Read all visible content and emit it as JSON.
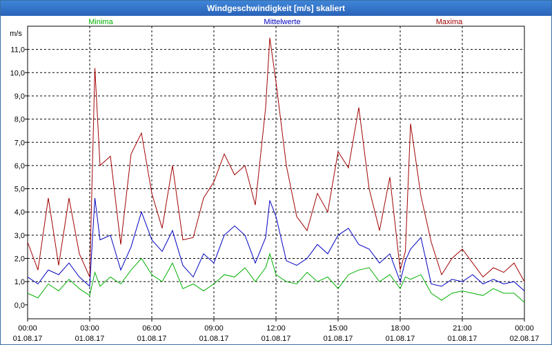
{
  "window": {
    "title": "Windgeschwindigkeit [m/s] skaliert"
  },
  "chart_data": {
    "type": "line",
    "title": "Windgeschwindigkeit [m/s] skaliert",
    "ylabel": "m/s",
    "ylim": [
      -0.6,
      12.0
    ],
    "yticks": [
      "0,0",
      "1,0",
      "2,0",
      "3,0",
      "4,0",
      "5,0",
      "6,0",
      "7,0",
      "8,0",
      "9,0",
      "10,0",
      "11,0"
    ],
    "xlabels": [
      {
        "time": "00:00",
        "date": "01.08.17"
      },
      {
        "time": "03:00",
        "date": "01.08.17"
      },
      {
        "time": "06:00",
        "date": "01.08.17"
      },
      {
        "time": "09:00",
        "date": "01.08.17"
      },
      {
        "time": "12:00",
        "date": "01.08.17"
      },
      {
        "time": "15:00",
        "date": "01.08.17"
      },
      {
        "time": "18:00",
        "date": "01.08.17"
      },
      {
        "time": "21:00",
        "date": "01.08.17"
      },
      {
        "time": "00:00",
        "date": "02.08.17"
      }
    ],
    "grid": true,
    "legend_placement": "top",
    "x_hours": [
      0,
      0.5,
      1,
      1.5,
      2,
      2.5,
      3,
      3.25,
      3.5,
      4,
      4.5,
      5,
      5.5,
      6,
      6.5,
      7,
      7.5,
      8,
      8.5,
      9,
      9.5,
      10,
      10.5,
      11,
      11.5,
      11.7,
      12,
      12.5,
      13,
      13.5,
      14,
      14.5,
      15,
      15.5,
      16,
      16.5,
      17,
      17.5,
      18,
      18.25,
      18.5,
      19,
      19.5,
      20,
      20.5,
      21,
      21.5,
      22,
      22.5,
      23,
      23.5,
      24
    ],
    "series": [
      {
        "name": "Minima",
        "color": "#00b000",
        "values": [
          0.5,
          0.3,
          0.9,
          0.6,
          1.1,
          0.7,
          0.4,
          1.4,
          0.8,
          1.2,
          0.9,
          1.5,
          2.0,
          1.3,
          1.0,
          1.8,
          0.7,
          0.9,
          0.6,
          0.9,
          1.3,
          1.2,
          1.6,
          1.0,
          1.6,
          2.2,
          1.3,
          1.0,
          0.9,
          1.4,
          1.0,
          1.2,
          0.7,
          1.3,
          1.5,
          1.6,
          1.0,
          1.3,
          0.7,
          1.2,
          1.1,
          1.3,
          0.5,
          0.2,
          0.5,
          0.6,
          0.5,
          0.4,
          0.7,
          0.5,
          0.5,
          0.1
        ]
      },
      {
        "name": "Mittelwerte",
        "color": "#0000c0",
        "values": [
          1.2,
          0.9,
          1.5,
          1.3,
          1.8,
          1.2,
          0.8,
          4.6,
          2.8,
          3.0,
          1.5,
          2.5,
          4.0,
          2.8,
          2.3,
          3.2,
          1.7,
          1.2,
          2.2,
          1.8,
          3.0,
          3.4,
          3.0,
          1.8,
          2.9,
          4.5,
          3.8,
          1.9,
          1.7,
          2.0,
          2.6,
          2.2,
          3.0,
          3.3,
          2.6,
          2.4,
          1.8,
          2.2,
          1.0,
          1.9,
          2.4,
          2.9,
          0.9,
          0.8,
          1.1,
          1.0,
          1.3,
          0.9,
          1.1,
          0.9,
          1.0,
          0.6
        ]
      },
      {
        "name": "Maxima",
        "color": "#a00000",
        "values": [
          2.7,
          1.5,
          4.6,
          1.7,
          4.6,
          2.2,
          1.2,
          10.2,
          6.0,
          6.4,
          2.6,
          6.5,
          7.4,
          4.8,
          3.3,
          6.0,
          2.8,
          2.9,
          4.6,
          5.3,
          6.5,
          5.6,
          6.0,
          4.3,
          8.5,
          11.5,
          9.6,
          6.0,
          3.8,
          3.2,
          4.8,
          4.0,
          6.6,
          5.9,
          8.5,
          5.0,
          3.2,
          5.5,
          1.5,
          2.3,
          7.8,
          4.7,
          2.7,
          1.3,
          2.0,
          2.4,
          1.8,
          1.2,
          1.6,
          1.4,
          1.8,
          1.0
        ]
      }
    ]
  }
}
